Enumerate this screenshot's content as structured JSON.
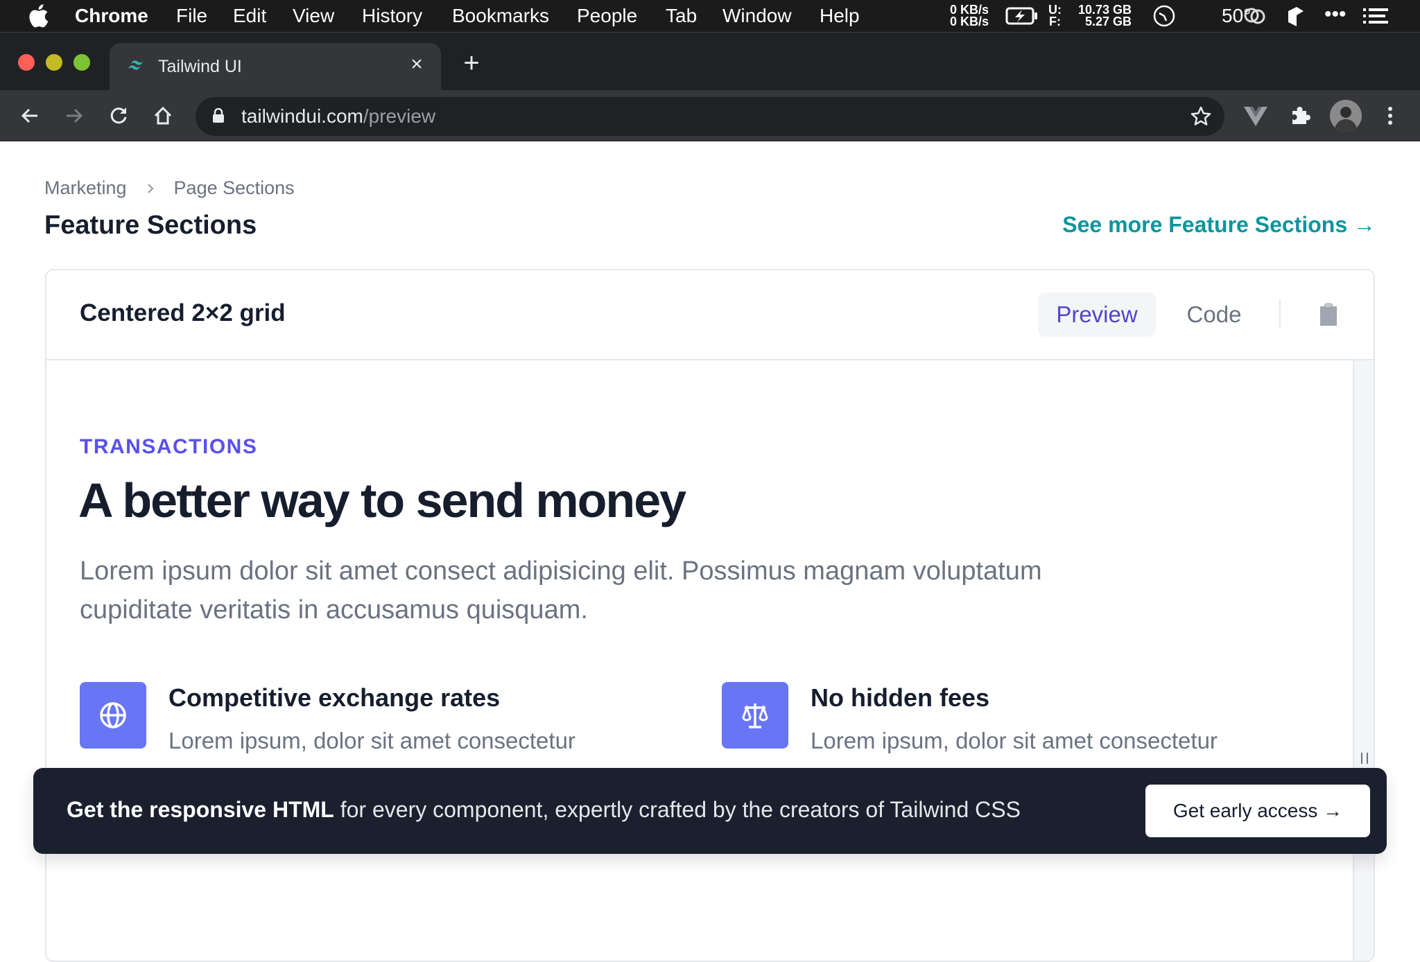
{
  "menubar": {
    "app": "Chrome",
    "items": [
      "File",
      "Edit",
      "View",
      "History",
      "Bookmarks",
      "People",
      "Tab",
      "Window",
      "Help"
    ],
    "status": {
      "net_up": "0 KB/s",
      "net_down": "0 KB/s",
      "disk_used_label": "U:",
      "disk_used": "10.73 GB",
      "disk_free_label": "F:",
      "disk_free": "5.27 GB",
      "temperature": "50°"
    }
  },
  "browser": {
    "tab_title": "Tailwind UI",
    "url_domain": "tailwindui.com",
    "url_path": "/preview"
  },
  "page": {
    "breadcrumb": [
      "Marketing",
      "Page Sections"
    ],
    "title": "Feature Sections",
    "see_more": "See more Feature Sections →"
  },
  "card": {
    "title": "Centered 2×2 grid",
    "tabs": [
      {
        "label": "Preview",
        "active": true
      },
      {
        "label": "Code",
        "active": false
      }
    ]
  },
  "preview": {
    "eyebrow": "TRANSACTIONS",
    "headline": "A better way to send money",
    "lede": "Lorem ipsum dolor sit amet consect adipisicing elit. Possimus magnam voluptatum cupiditate veritatis in accusamus quisquam.",
    "features": [
      {
        "icon": "globe-icon",
        "title": "Competitive exchange rates",
        "description": "Lorem ipsum, dolor sit amet consectetur"
      },
      {
        "icon": "scale-icon",
        "title": "No hidden fees",
        "description": "Lorem ipsum, dolor sit amet consectetur"
      }
    ]
  },
  "banner": {
    "message_strong": "Get the responsive HTML",
    "message_rest": " for every component, expertly crafted by the creators of Tailwind CSS",
    "cta": "Get early access →"
  },
  "colors": {
    "accent": "#5850ec",
    "link": "#0e949d",
    "icon_bg": "#6875f5",
    "banner_bg": "#1a202e"
  }
}
